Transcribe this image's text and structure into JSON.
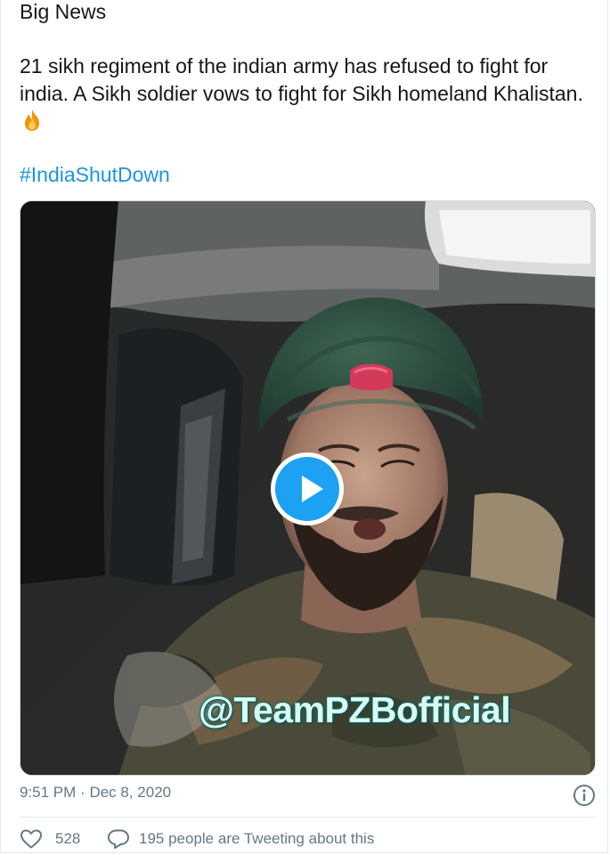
{
  "tweet": {
    "heading": "Big News",
    "body": "21 sikh regiment of the indian army has refused to fight for india. A Sikh soldier vows to fight for Sikh homeland Khalistan.",
    "emoji": "fire-emoji",
    "hashtag": "#IndiaShutDown"
  },
  "media": {
    "type": "video",
    "watermark": "@TeamPZBofficial",
    "play_icon": "play-icon"
  },
  "meta": {
    "time": "9:51 PM",
    "separator": "·",
    "date": "Dec 8, 2020",
    "info_icon": "info-icon"
  },
  "actions": {
    "like_icon": "heart-icon",
    "like_count": "528",
    "reply_icon": "speech-bubble-icon",
    "conversation_text": "195 people are Tweeting about this"
  },
  "colors": {
    "text": "#14171a",
    "link": "#1b95e0",
    "muted": "#657786",
    "play": "#1da1f2",
    "border": "#e1e8ed"
  }
}
